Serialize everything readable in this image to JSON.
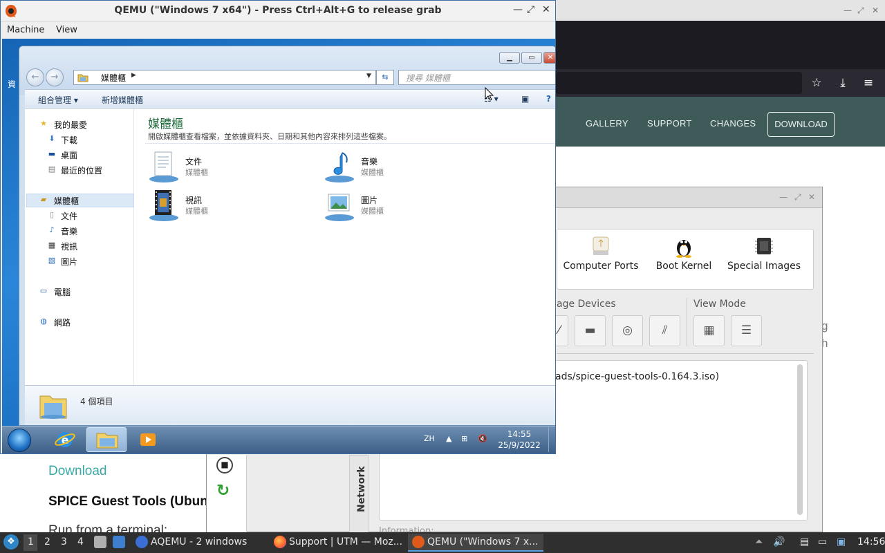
{
  "host_browser": {
    "nav": {
      "gallery": "GALLERY",
      "support": "SUPPORT",
      "changes": "CHANGES",
      "download": "DOWNLOAD"
    },
    "side_letters": [
      "g",
      "h"
    ],
    "page": {
      "download_link": "Download",
      "spice_heading": "SPICE Guest Tools (Ubun",
      "run_text": "Run from a terminal:"
    },
    "colors": {
      "nav_bg": "#3f5b59",
      "link": "#3aa9a5",
      "toolbar": "#2b2a33"
    }
  },
  "utm": {
    "tools": [
      {
        "label": "Computer Ports",
        "icon": "usb-port-icon"
      },
      {
        "label": "Boot Kernel",
        "icon": "penguin-icon"
      },
      {
        "label": "Special Images",
        "icon": "chip-icon"
      }
    ],
    "storage_section": "age Devices",
    "view_section": "View Mode",
    "console_text": "ads/spice-guest-tools-0.164.3.iso)",
    "info_label": "Information:",
    "network_tab": "Network"
  },
  "qemu": {
    "title": "QEMU (\"Windows 7 x64\") - Press Ctrl+Alt+G to release grab",
    "menu": {
      "machine": "Machine",
      "view": "View"
    },
    "desktop_label": "資",
    "explorer": {
      "address": "媒體櫃",
      "search_placeholder": "搜尋 媒體櫃",
      "commands": {
        "organize": "組合管理",
        "new_library": "新增媒體櫃"
      },
      "nav": {
        "favorites": "我的最愛",
        "downloads": "下載",
        "desktop": "桌面",
        "recent": "最近的位置",
        "libraries": "媒體櫃",
        "documents": "文件",
        "music": "音樂",
        "videos": "視訊",
        "pictures": "圖片",
        "computer": "電腦",
        "network": "網路"
      },
      "heading": "媒體櫃",
      "description": "開啟媒體櫃查看檔案，並依據資料夾、日期和其他內容來排列這些檔案。",
      "libraries": [
        {
          "name": "文件",
          "sub": "媒體櫃",
          "icon": "documents-library-icon"
        },
        {
          "name": "音樂",
          "sub": "媒體櫃",
          "icon": "music-library-icon"
        },
        {
          "name": "視訊",
          "sub": "媒體櫃",
          "icon": "videos-library-icon"
        },
        {
          "name": "圖片",
          "sub": "媒體櫃",
          "icon": "pictures-library-icon"
        }
      ],
      "item_count": "4 個項目"
    },
    "taskbar": {
      "lang": "ZH",
      "time": "14:55",
      "date": "25/9/2022"
    }
  },
  "host_taskbar": {
    "workspaces": [
      "1",
      "2",
      "3",
      "4"
    ],
    "tasks": [
      {
        "label": "AQEMU - 2 windows",
        "icon": "aqemu-icon"
      },
      {
        "label": "Support | UTM — Moz...",
        "icon": "firefox-icon"
      },
      {
        "label": "QEMU (\"Windows 7 x...",
        "icon": "qemu-icon"
      }
    ],
    "clock": "14:56"
  }
}
